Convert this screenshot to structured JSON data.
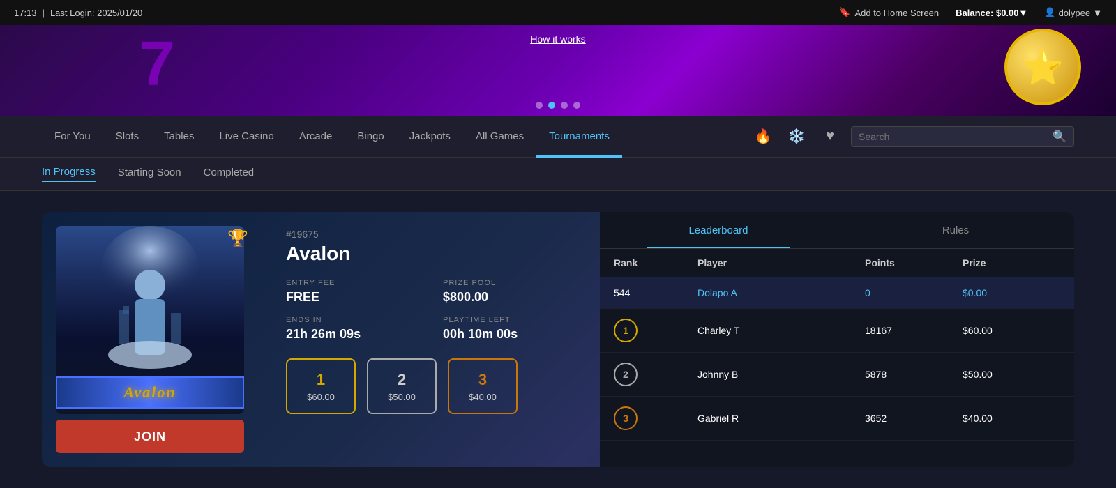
{
  "topbar": {
    "time": "17:13",
    "separator": "|",
    "last_login": "Last Login: 2025/01/20",
    "add_home": "Add to Home Screen",
    "balance_label": "Balance:",
    "balance_value": "$0.00",
    "user": "dolypee"
  },
  "banner": {
    "how_it_works": "How it works",
    "dots": [
      false,
      true,
      false,
      false
    ]
  },
  "nav": {
    "items": [
      {
        "label": "For You",
        "active": false
      },
      {
        "label": "Slots",
        "active": false
      },
      {
        "label": "Tables",
        "active": false
      },
      {
        "label": "Live Casino",
        "active": false
      },
      {
        "label": "Arcade",
        "active": false
      },
      {
        "label": "Bingo",
        "active": false
      },
      {
        "label": "Jackpots",
        "active": false
      },
      {
        "label": "All Games",
        "active": false
      },
      {
        "label": "Tournaments",
        "active": true
      }
    ],
    "search_placeholder": "Search"
  },
  "subnav": {
    "items": [
      {
        "label": "In Progress",
        "active": true
      },
      {
        "label": "Starting Soon",
        "active": false
      },
      {
        "label": "Completed",
        "active": false
      }
    ]
  },
  "tournament": {
    "id": "#19675",
    "name": "Avalon",
    "entry_fee_label": "ENTRY FEE",
    "entry_fee": "FREE",
    "prize_pool_label": "PRIZE POOL",
    "prize_pool": "$800.00",
    "ends_in_label": "ENDS IN",
    "ends_in": "21h 26m 09s",
    "playtime_label": "PLAYTIME LEFT",
    "playtime": "00h 10m 00s",
    "join_label": "JOIN",
    "prizes": [
      {
        "rank": "1",
        "amount": "$60.00",
        "type": "gold"
      },
      {
        "rank": "2",
        "amount": "$50.00",
        "type": "silver"
      },
      {
        "rank": "3",
        "amount": "$40.00",
        "type": "bronze"
      }
    ],
    "leaderboard": {
      "tab_leaderboard": "Leaderboard",
      "tab_rules": "Rules",
      "columns": [
        "Rank",
        "Player",
        "Points",
        "Prize"
      ],
      "user_row": {
        "rank": "544",
        "player": "Dolapo A",
        "points": "0",
        "prize": "$0.00"
      },
      "rows": [
        {
          "rank": "1",
          "rank_type": "gold",
          "player": "Charley T",
          "points": "18167",
          "prize": "$60.00"
        },
        {
          "rank": "2",
          "rank_type": "silver",
          "player": "Johnny B",
          "points": "5878",
          "prize": "$50.00"
        },
        {
          "rank": "3",
          "rank_type": "bronze",
          "player": "Gabriel R",
          "points": "3652",
          "prize": "$40.00"
        }
      ]
    }
  }
}
